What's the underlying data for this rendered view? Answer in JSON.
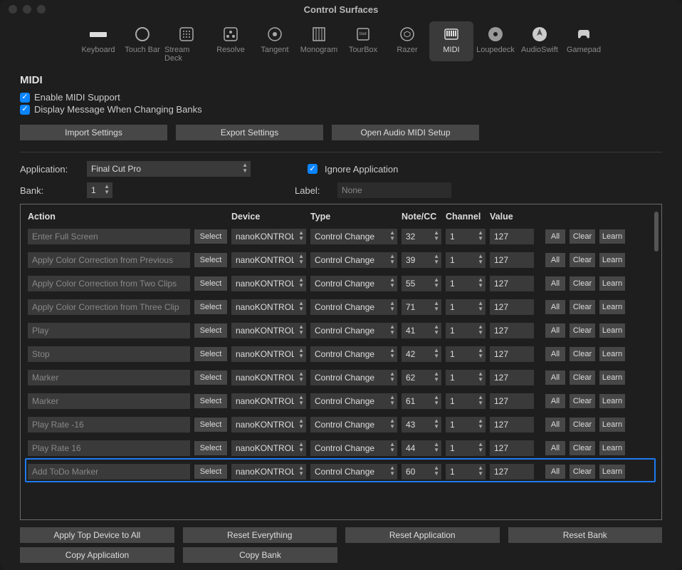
{
  "window_title": "Control Surfaces",
  "tabs": [
    {
      "label": "Keyboard"
    },
    {
      "label": "Touch Bar"
    },
    {
      "label": "Stream Deck"
    },
    {
      "label": "Resolve"
    },
    {
      "label": "Tangent"
    },
    {
      "label": "Monogram"
    },
    {
      "label": "TourBox"
    },
    {
      "label": "Razer"
    },
    {
      "label": "MIDI"
    },
    {
      "label": "Loupedeck"
    },
    {
      "label": "AudioSwift"
    },
    {
      "label": "Gamepad"
    }
  ],
  "active_tab": 8,
  "section_title": "MIDI",
  "checkboxes": {
    "enable": "Enable MIDI Support",
    "display_msg": "Display Message When Changing Banks"
  },
  "buttons": {
    "import": "Import Settings",
    "export": "Export Settings",
    "open_setup": "Open Audio MIDI Setup"
  },
  "form": {
    "application_label": "Application:",
    "application_value": "Final Cut Pro",
    "ignore_label": "Ignore Application",
    "bank_label": "Bank:",
    "bank_value": "1",
    "label_label": "Label:",
    "label_value": "None"
  },
  "headers": {
    "action": "Action",
    "device": "Device",
    "type": "Type",
    "note": "Note/CC",
    "channel": "Channel",
    "value": "Value"
  },
  "row_btns": {
    "select": "Select",
    "all": "All",
    "clear": "Clear",
    "learn": "Learn"
  },
  "rows": [
    {
      "action": "Enter Full Screen",
      "device": "nanoKONTROL",
      "type": "Control Change",
      "note": "32",
      "channel": "1",
      "value": "127",
      "hl": false
    },
    {
      "action": "Apply Color Correction from Previous",
      "device": "nanoKONTROL",
      "type": "Control Change",
      "note": "39",
      "channel": "1",
      "value": "127",
      "hl": false
    },
    {
      "action": "Apply Color Correction from Two Clips",
      "device": "nanoKONTROL",
      "type": "Control Change",
      "note": "55",
      "channel": "1",
      "value": "127",
      "hl": false
    },
    {
      "action": "Apply Color Correction from Three Clip",
      "device": "nanoKONTROL",
      "type": "Control Change",
      "note": "71",
      "channel": "1",
      "value": "127",
      "hl": false
    },
    {
      "action": "Play",
      "device": "nanoKONTROL",
      "type": "Control Change",
      "note": "41",
      "channel": "1",
      "value": "127",
      "hl": false
    },
    {
      "action": "Stop",
      "device": "nanoKONTROL",
      "type": "Control Change",
      "note": "42",
      "channel": "1",
      "value": "127",
      "hl": false
    },
    {
      "action": "Marker",
      "device": "nanoKONTROL",
      "type": "Control Change",
      "note": "62",
      "channel": "1",
      "value": "127",
      "hl": false
    },
    {
      "action": "Marker",
      "device": "nanoKONTROL",
      "type": "Control Change",
      "note": "61",
      "channel": "1",
      "value": "127",
      "hl": false
    },
    {
      "action": "Play Rate -16",
      "device": "nanoKONTROL",
      "type": "Control Change",
      "note": "43",
      "channel": "1",
      "value": "127",
      "hl": false
    },
    {
      "action": "Play Rate 16",
      "device": "nanoKONTROL",
      "type": "Control Change",
      "note": "44",
      "channel": "1",
      "value": "127",
      "hl": false
    },
    {
      "action": "Add ToDo Marker",
      "device": "nanoKONTROL",
      "type": "Control Change",
      "note": "60",
      "channel": "1",
      "value": "127",
      "hl": true
    }
  ],
  "footer": {
    "apply_top": "Apply Top Device to All",
    "reset_everything": "Reset Everything",
    "reset_app": "Reset Application",
    "reset_bank": "Reset Bank",
    "copy_app": "Copy Application",
    "copy_bank": "Copy Bank"
  }
}
